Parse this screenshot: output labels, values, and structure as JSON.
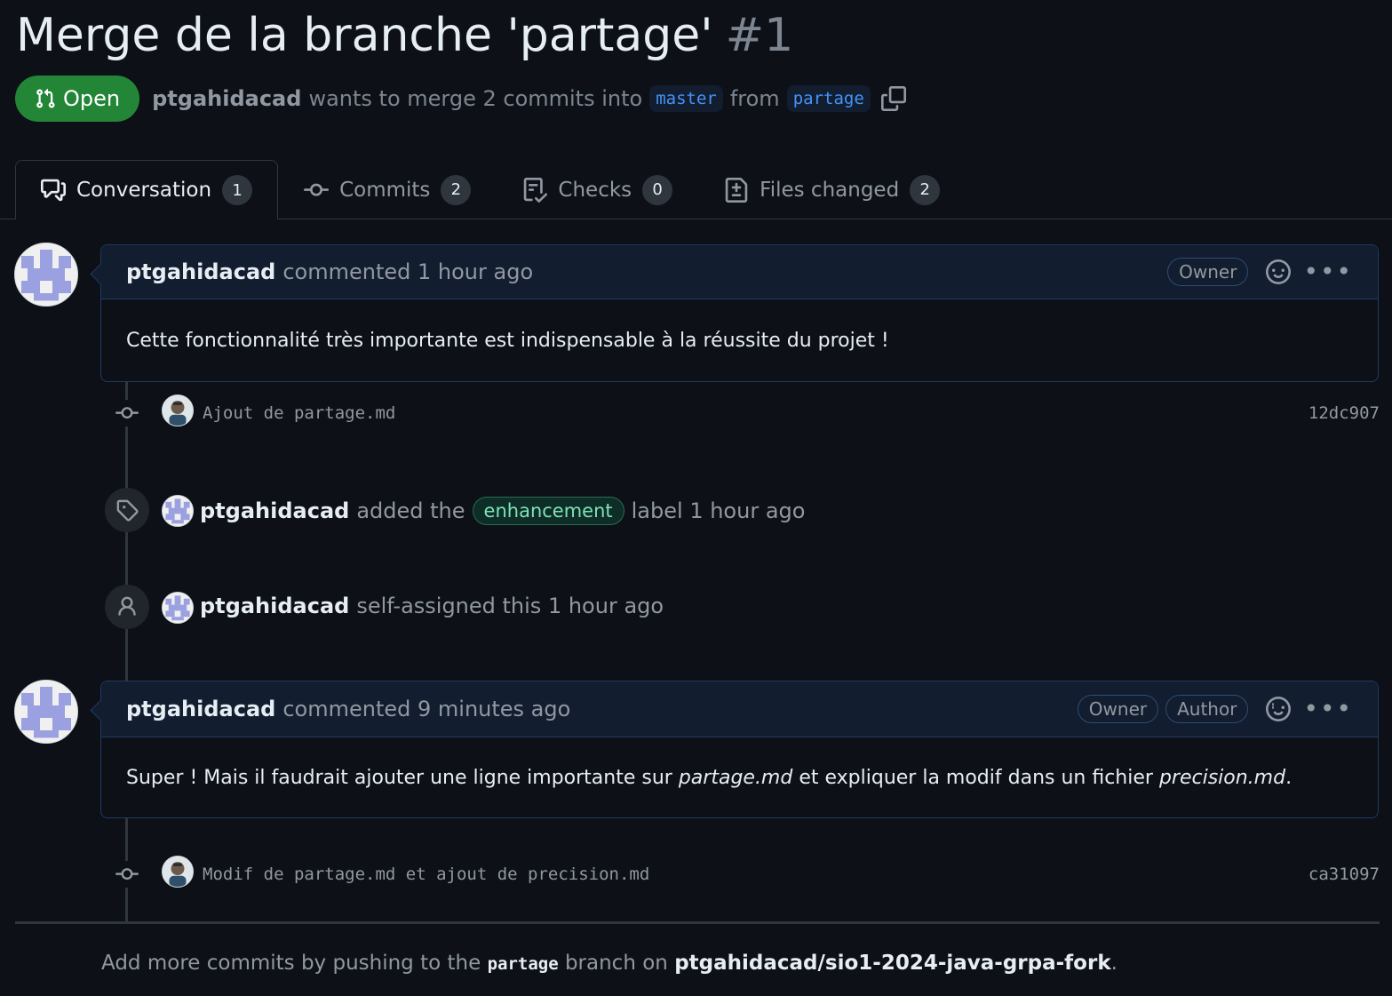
{
  "pr": {
    "title": "Merge de la branche 'partage'",
    "number": "#1",
    "state": "Open",
    "author": "ptgahidacad",
    "merge_text_1": "wants to merge 2 commits into",
    "base_branch": "master",
    "from_text": "from",
    "head_branch": "partage"
  },
  "tabs": [
    {
      "label": "Conversation",
      "count": "1",
      "icon": "comment-discussion-icon"
    },
    {
      "label": "Commits",
      "count": "2",
      "icon": "git-commit-icon"
    },
    {
      "label": "Checks",
      "count": "0",
      "icon": "checklist-icon"
    },
    {
      "label": "Files changed",
      "count": "2",
      "icon": "file-diff-icon"
    }
  ],
  "comments": [
    {
      "user": "ptgahidacad",
      "action": "commented",
      "time": "1 hour ago",
      "roles": [
        "Owner"
      ],
      "body": "Cette fonctionnalité très importante est indispensable à la réussite du projet !"
    },
    {
      "user": "ptgahidacad",
      "action": "commented",
      "time": "9 minutes ago",
      "roles": [
        "Owner",
        "Author"
      ],
      "body_parts": [
        "Super ! Mais il faudrait ajouter une ligne importante sur ",
        "partage.md",
        " et expliquer la modif dans un fichier ",
        "precision.md",
        "."
      ]
    }
  ],
  "commits": [
    {
      "message": "Ajout de partage.md",
      "sha": "12dc907"
    },
    {
      "message": "Modif de partage.md et ajout de precision.md",
      "sha": "ca31097"
    }
  ],
  "events": {
    "label": {
      "user": "ptgahidacad",
      "text_before": "added the",
      "label": "enhancement",
      "text_after": "label 1 hour ago",
      "icon": "tag-icon"
    },
    "assign": {
      "user": "ptgahidacad",
      "text": "self-assigned this 1 hour ago",
      "icon": "person-icon"
    }
  },
  "footer": {
    "text_1": "Add more commits by pushing to the",
    "branch": "partage",
    "text_2": "branch on",
    "repo": "ptgahidacad/sio1-2024-java-grpa-fork",
    "text_3": "."
  },
  "colors": {
    "open_green": "#238636",
    "branch_blue": "#4493f8",
    "comment_border": "#1f3a63",
    "label_green": "#7ee2b8"
  }
}
